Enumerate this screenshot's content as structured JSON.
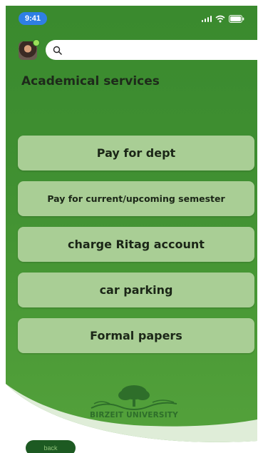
{
  "status_bar": {
    "time": "9:41",
    "icons": [
      "signal-icon",
      "wifi-icon",
      "battery-icon"
    ]
  },
  "header": {
    "search_placeholder": "",
    "search_value": ""
  },
  "main": {
    "title": "Academical services",
    "buttons": [
      {
        "label": "Pay for dept"
      },
      {
        "label": "Pay for current/upcoming semester"
      },
      {
        "label": "charge Ritag account"
      },
      {
        "label": "car parking"
      },
      {
        "label": "Formal papers"
      }
    ]
  },
  "footer": {
    "logo_text": "BIRZEIT UNIVERSITY",
    "back_label": "back"
  },
  "colors": {
    "background": "#3f8f31",
    "button_fill": "#a9ce95",
    "time_pill": "#2f7fe4",
    "back_button": "#1d5a22"
  }
}
